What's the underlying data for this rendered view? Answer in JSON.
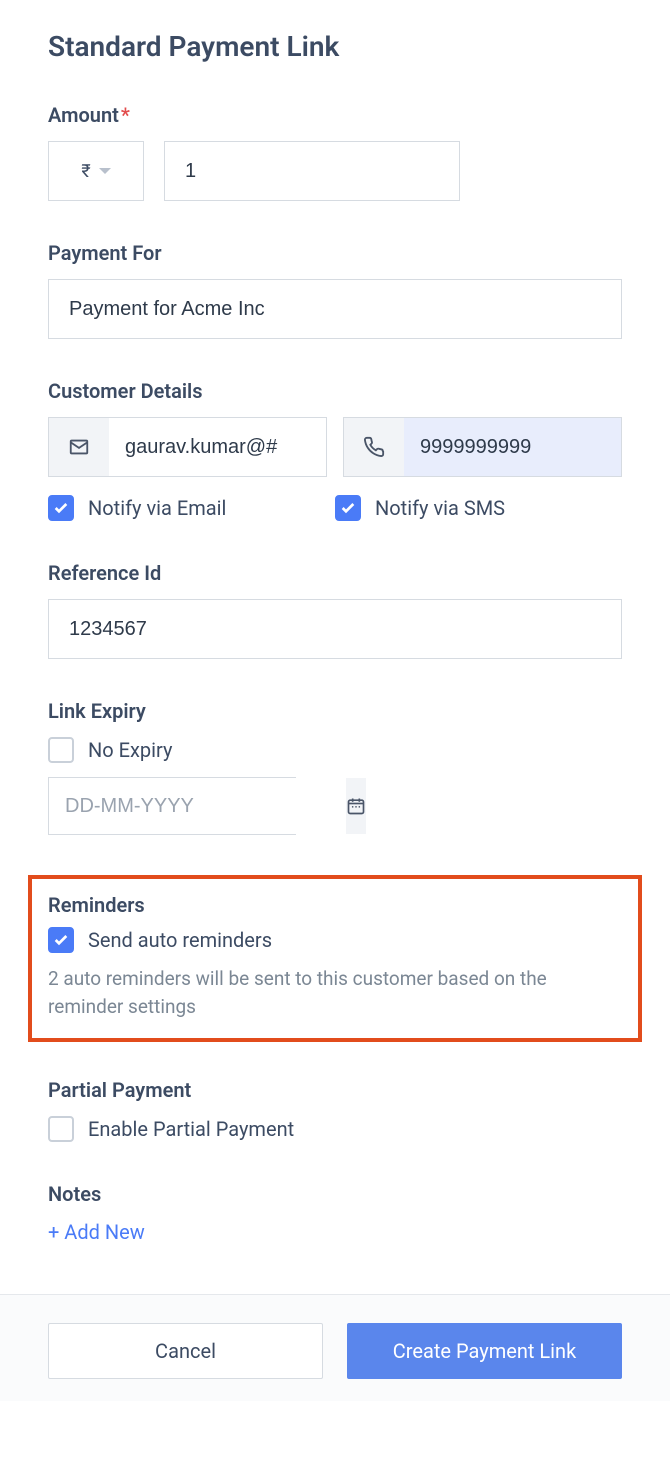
{
  "page_title": "Standard Payment Link",
  "amount": {
    "label": "Amount",
    "required": "*",
    "currency_symbol": "₹",
    "value": "1"
  },
  "payment_for": {
    "label": "Payment For",
    "value": "Payment for Acme Inc"
  },
  "customer": {
    "label": "Customer Details",
    "email_value": "gaurav.kumar@#",
    "phone_value": "9999999999",
    "notify_email_label": "Notify via Email",
    "notify_sms_label": "Notify via SMS"
  },
  "reference": {
    "label": "Reference Id",
    "value": "1234567"
  },
  "expiry": {
    "label": "Link Expiry",
    "no_expiry_label": "No Expiry",
    "date_placeholder": "DD-MM-YYYY"
  },
  "reminders": {
    "label": "Reminders",
    "checkbox_label": "Send auto reminders",
    "helper": "2 auto reminders will be sent to this customer based on the reminder settings"
  },
  "partial": {
    "label": "Partial Payment",
    "checkbox_label": "Enable Partial Payment"
  },
  "notes": {
    "label": "Notes",
    "add_new": "+ Add New"
  },
  "footer": {
    "cancel": "Cancel",
    "submit": "Create Payment Link"
  }
}
